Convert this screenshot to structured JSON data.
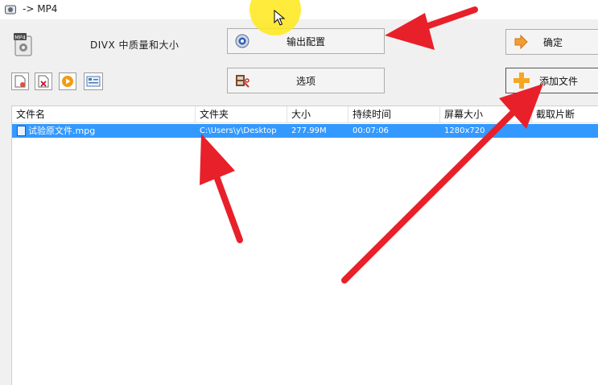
{
  "window": {
    "title": "-> MP4"
  },
  "profile": {
    "label": "DIVX 中质量和大小"
  },
  "buttons": {
    "output_config": "输出配置",
    "options": "选项",
    "ok": "确定",
    "add_file": "添加文件"
  },
  "toolbar": {
    "icons": [
      "new-file-icon",
      "delete-file-icon",
      "play-icon",
      "media-info-icon"
    ]
  },
  "list": {
    "columns": [
      "文件名",
      "文件夹",
      "大小",
      "持续时间",
      "屏幕大小",
      "截取片断"
    ],
    "rows": [
      {
        "name": "试验原文件.mpg",
        "folder": "C:\\Users\\y\\Desktop",
        "size": "277.99M",
        "duration": "00:07:06",
        "screen": "1280x720",
        "clip": "",
        "selected": true
      }
    ]
  },
  "colors": {
    "selection": "#3399ff",
    "annotation_arrow": "#e8202a",
    "cursor_highlight": "#ffe81a"
  }
}
